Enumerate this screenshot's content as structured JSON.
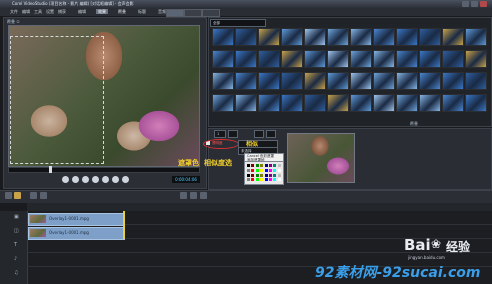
{
  "window": {
    "title": "Corel VideoStudio (项目名称 - 影片 编辑) [对话框编辑] - 会声会影"
  },
  "menu": {
    "items": [
      "文件",
      "编辑",
      "工具",
      "设置",
      "捕获",
      "编辑",
      "效果",
      "覆叠",
      "标题",
      "音频",
      "分享"
    ],
    "active_index": 6
  },
  "preview": {
    "label": "覆叠 ①",
    "timecode": "0:00:04:06"
  },
  "effects": {
    "category": "全部",
    "section_label": "覆叠"
  },
  "properties": {
    "field1": "1",
    "field2": "未选择",
    "transparency_label": "透明度",
    "menu_items": [
      "Cancel 色彩遮罩",
      "添加遮罩帧"
    ]
  },
  "annotations": {
    "color_key": "遮罩色",
    "similarity": "相似度选",
    "label_a": "相似"
  },
  "timeline": {
    "clips": [
      {
        "label": "Overlay1-0001.mpg"
      },
      {
        "label": "Overlay1-0001.mpg"
      }
    ]
  },
  "watermark": {
    "baidu_a": "Bai",
    "baidu_b": "经验",
    "baidu_url": "jingyan.baidu.com",
    "site": "92素材网-92sucai.com"
  },
  "colors": {
    "accent": "#4fd0ff",
    "annotation": "#f2d02a",
    "clip": "#7ea0c8"
  }
}
